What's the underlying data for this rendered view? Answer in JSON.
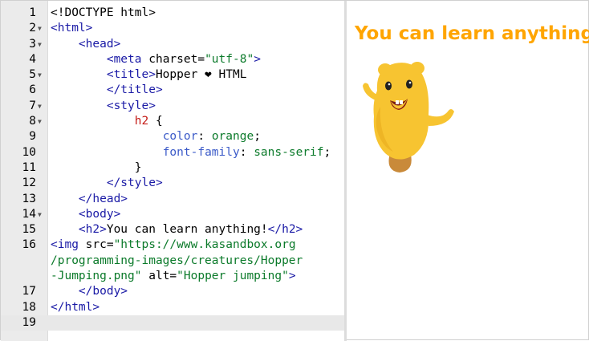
{
  "editor": {
    "lines": [
      {
        "n": "1",
        "fold": false,
        "parts": [
          [
            "plain",
            "<!DOCTYPE html>"
          ]
        ]
      },
      {
        "n": "2",
        "fold": true,
        "parts": [
          [
            "tag",
            "<html>"
          ]
        ]
      },
      {
        "n": "3",
        "fold": true,
        "parts": [
          [
            "plain",
            "    "
          ],
          [
            "tag",
            "<head>"
          ]
        ]
      },
      {
        "n": "4",
        "fold": false,
        "parts": [
          [
            "plain",
            "        "
          ],
          [
            "tag",
            "<meta "
          ],
          [
            "attr",
            "charset="
          ],
          [
            "str",
            "\"utf-8\""
          ],
          [
            "tag",
            ">"
          ]
        ]
      },
      {
        "n": "5",
        "fold": true,
        "parts": [
          [
            "plain",
            "        "
          ],
          [
            "tag",
            "<title>"
          ],
          [
            "plain",
            "Hopper ❤ HTML"
          ]
        ]
      },
      {
        "n": "6",
        "fold": false,
        "parts": [
          [
            "plain",
            "        "
          ],
          [
            "tag",
            "</title>"
          ]
        ]
      },
      {
        "n": "7",
        "fold": true,
        "parts": [
          [
            "plain",
            "        "
          ],
          [
            "tag",
            "<style>"
          ]
        ]
      },
      {
        "n": "8",
        "fold": true,
        "parts": [
          [
            "plain",
            "            "
          ],
          [
            "sel",
            "h2"
          ],
          [
            "plain",
            " {"
          ]
        ]
      },
      {
        "n": "9",
        "fold": false,
        "parts": [
          [
            "plain",
            "                "
          ],
          [
            "prop",
            "color"
          ],
          [
            "plain",
            ": "
          ],
          [
            "val",
            "orange"
          ],
          [
            "plain",
            ";"
          ]
        ]
      },
      {
        "n": "10",
        "fold": false,
        "parts": [
          [
            "plain",
            "                "
          ],
          [
            "prop",
            "font-family"
          ],
          [
            "plain",
            ": "
          ],
          [
            "val",
            "sans-serif"
          ],
          [
            "plain",
            ";"
          ]
        ]
      },
      {
        "n": "11",
        "fold": false,
        "parts": [
          [
            "plain",
            "            }"
          ]
        ]
      },
      {
        "n": "12",
        "fold": false,
        "parts": [
          [
            "plain",
            "        "
          ],
          [
            "tag",
            "</style>"
          ]
        ]
      },
      {
        "n": "13",
        "fold": false,
        "parts": [
          [
            "plain",
            "    "
          ],
          [
            "tag",
            "</head>"
          ]
        ]
      },
      {
        "n": "14",
        "fold": true,
        "parts": [
          [
            "plain",
            "    "
          ],
          [
            "tag",
            "<body>"
          ]
        ]
      },
      {
        "n": "15",
        "fold": false,
        "parts": [
          [
            "plain",
            "    "
          ],
          [
            "tag",
            "<h2>"
          ],
          [
            "plain",
            "You can learn anything!"
          ],
          [
            "tag",
            "</h2>"
          ]
        ]
      },
      {
        "n": "16",
        "fold": false,
        "parts": [
          [
            "tag",
            "<img "
          ],
          [
            "attr",
            "src="
          ],
          [
            "str",
            "\"https://www.kasandbox.org"
          ]
        ]
      },
      {
        "n": "",
        "fold": false,
        "parts": [
          [
            "str",
            "/programming-images/creatures/Hopper"
          ]
        ]
      },
      {
        "n": "",
        "fold": false,
        "parts": [
          [
            "str",
            "-Jumping.png\""
          ],
          [
            "attr",
            " alt="
          ],
          [
            "str",
            "\"Hopper jumping\""
          ],
          [
            "tag",
            ">"
          ]
        ]
      },
      {
        "n": "17",
        "fold": false,
        "parts": [
          [
            "plain",
            "    "
          ],
          [
            "tag",
            "</body>"
          ]
        ]
      },
      {
        "n": "18",
        "fold": false,
        "parts": [
          [
            "tag",
            "</html>"
          ]
        ]
      },
      {
        "n": "19",
        "fold": false,
        "parts": [
          [
            "plain",
            ""
          ]
        ],
        "active": true
      }
    ]
  },
  "preview": {
    "heading": "You can learn anything!",
    "image_alt": "Hopper jumping"
  },
  "colors": {
    "tag": "#1a1aa6",
    "string": "#0b7a2a",
    "selector": "#c41a16",
    "property": "#3b5ac8",
    "heading": "orange"
  }
}
